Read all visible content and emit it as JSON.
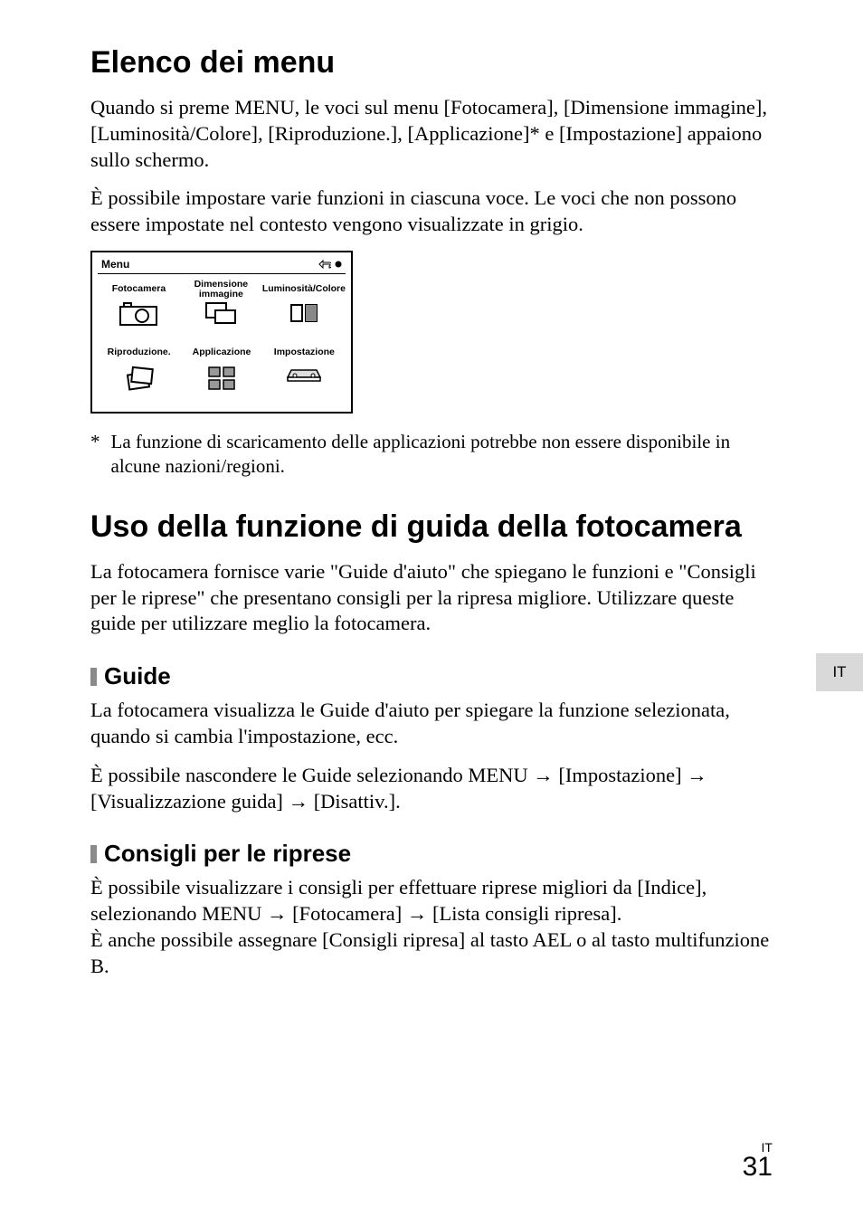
{
  "heading1": "Elenco dei menu",
  "para1": "Quando si preme MENU, le voci sul menu [Fotocamera], [Dimensione immagine], [Luminosità/Colore], [Riproduzione.], [Applicazione]* e [Impostazione] appaiono sullo schermo.",
  "para2": "È possibile impostare varie funzioni in ciascuna voce. Le voci che non possono essere impostate nel contesto vengono visualizzate in grigio.",
  "menu": {
    "title": "Menu",
    "cells": [
      "Fotocamera",
      "Dimensione immagine",
      "Luminosità/Colore",
      "Riproduzione.",
      "Applicazione",
      "Impostazione"
    ]
  },
  "footnote_star": "*",
  "footnote": "La funzione di scaricamento delle applicazioni potrebbe non essere disponibile in alcune nazioni/regioni.",
  "heading2": "Uso della funzione di guida della fotocamera",
  "para3": "La fotocamera fornisce varie \"Guide d'aiuto\" che spiegano le funzioni e \"Consigli per le riprese\" che presentano consigli per la ripresa migliore. Utilizzare queste guide per utilizzare meglio la fotocamera.",
  "sub1": "Guide",
  "para4": "La fotocamera visualizza le Guide d'aiuto per spiegare la funzione selezionata, quando si cambia l'impostazione, ecc.",
  "para5_a": "È possibile nascondere le Guide selezionando MENU ",
  "para5_b": " [Impostazione] ",
  "para5_c": " [Visualizzazione guida] ",
  "para5_d": " [Disattiv.].",
  "sub2": "Consigli per le riprese",
  "para6_a": "È possibile visualizzare i consigli per effettuare riprese migliori da [Indice], selezionando MENU ",
  "para6_b": " [Fotocamera] ",
  "para6_c": " [Lista consigli ripresa].",
  "para7": "È anche possibile assegnare [Consigli ripresa] al tasto AEL o al tasto multifunzione B.",
  "side_lang": "IT",
  "footer_lang": "IT",
  "page_number": "31",
  "arrow": "→"
}
